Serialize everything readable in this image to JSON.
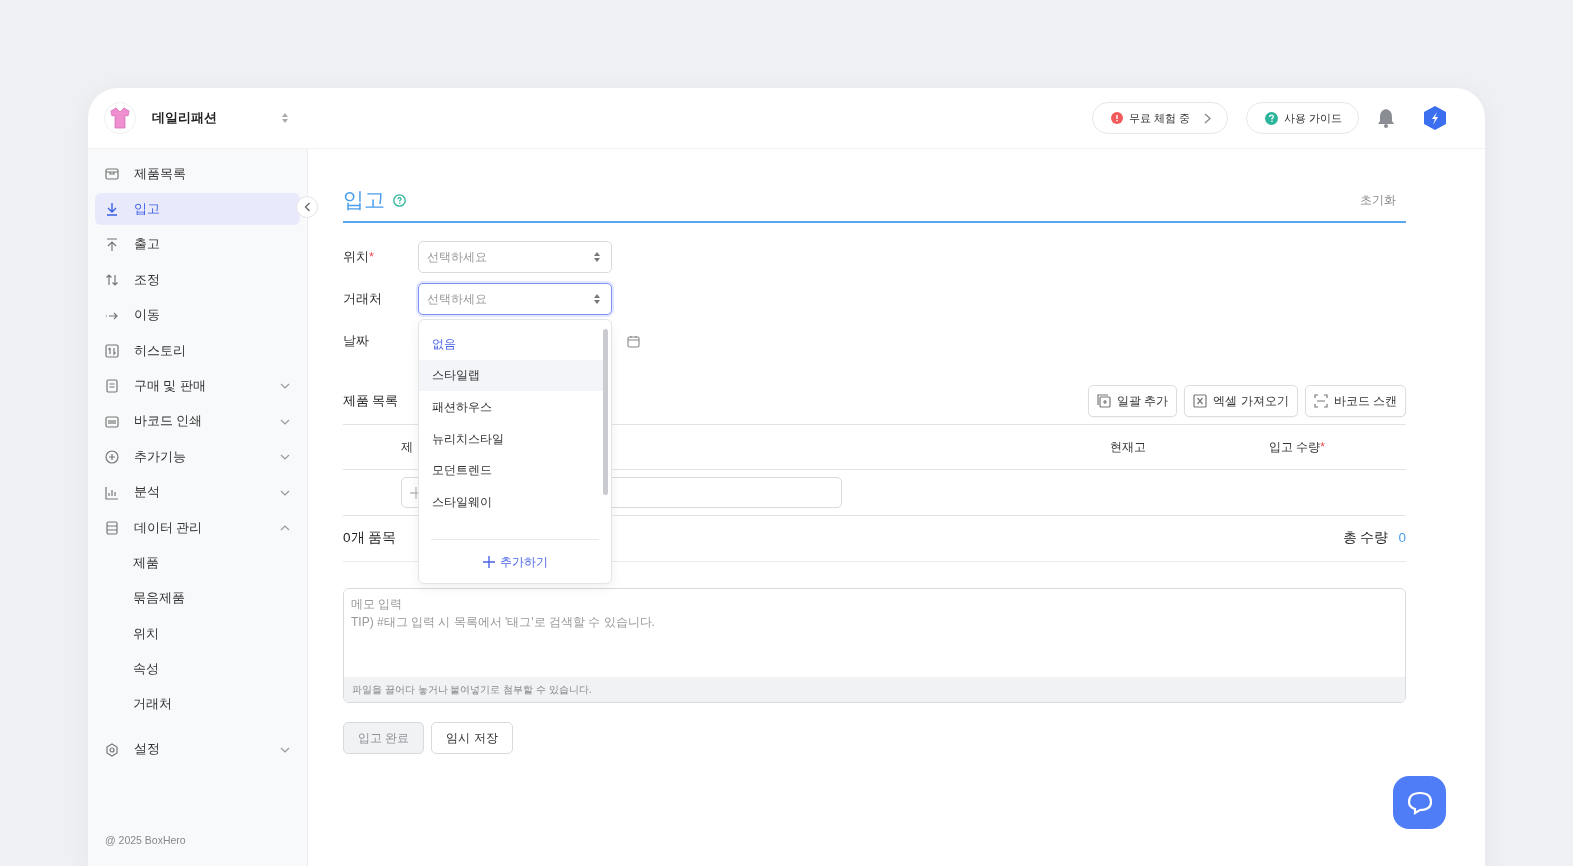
{
  "workspace": {
    "name": "데일리패션"
  },
  "header": {
    "trial_button": "무료 체험 중",
    "guide_button": "사용 가이드"
  },
  "sidebar": {
    "items": [
      {
        "label": "제품목록",
        "kind": "link",
        "selected": false
      },
      {
        "label": "입고",
        "kind": "link",
        "selected": true
      },
      {
        "label": "출고",
        "kind": "link",
        "selected": false
      },
      {
        "label": "조정",
        "kind": "link",
        "selected": false
      },
      {
        "label": "이동",
        "kind": "link",
        "selected": false
      },
      {
        "label": "히스토리",
        "kind": "link",
        "selected": false
      },
      {
        "label": "구매 및 판매",
        "kind": "group",
        "selected": false,
        "expanded": false
      },
      {
        "label": "바코드 인쇄",
        "kind": "group",
        "selected": false,
        "expanded": false
      },
      {
        "label": "추가기능",
        "kind": "group",
        "selected": false,
        "expanded": false
      },
      {
        "label": "분석",
        "kind": "group",
        "selected": false,
        "expanded": false
      },
      {
        "label": "데이터 관리",
        "kind": "group",
        "selected": false,
        "expanded": true,
        "children": [
          {
            "label": "제품",
            "selected": false
          },
          {
            "label": "묶음제품",
            "selected": false
          },
          {
            "label": "위치",
            "selected": false
          },
          {
            "label": "속성",
            "selected": false
          },
          {
            "label": "거래처",
            "selected": false
          }
        ]
      },
      {
        "label": "설정",
        "kind": "group",
        "selected": false,
        "expanded": false
      }
    ],
    "footer": "@ 2025 BoxHero"
  },
  "page": {
    "title": "입고",
    "reset_button": "초기화"
  },
  "form": {
    "fields": [
      {
        "label": "위치",
        "required_mark": "*",
        "kind": "select",
        "placeholder": "선택하세요",
        "focused": false
      },
      {
        "label": "거래처",
        "kind": "select",
        "placeholder": "선택하세요",
        "focused": true
      },
      {
        "label": "날짜",
        "kind": "date"
      }
    ]
  },
  "dropdown": {
    "options": [
      {
        "label": "없음",
        "selected": true,
        "hovered": false
      },
      {
        "label": "스타일랩",
        "selected": false,
        "hovered": true
      },
      {
        "label": "패션하우스",
        "selected": false,
        "hovered": false
      },
      {
        "label": "뉴리치스타일",
        "selected": false,
        "hovered": false
      },
      {
        "label": "모던트렌드",
        "selected": false,
        "hovered": false
      },
      {
        "label": "스타일웨이",
        "selected": false,
        "hovered": false
      }
    ],
    "add_button": "추가하기"
  },
  "products": {
    "label": "제품 목록",
    "actions": [
      "일괄 추가",
      "엑셀 가져오기",
      "바코드 스캔"
    ],
    "columns": [
      {
        "label": "제"
      },
      {
        "label": "현재고"
      },
      {
        "label": "입고 수량",
        "required_mark": "*"
      }
    ],
    "item_count": "0개 품목",
    "total_label": "총 수량",
    "total_value": "0"
  },
  "memo": {
    "placeholder": "메모 입력\nTIP) #태그 입력 시 목록에서 '태그'로 검색할 수 있습니다.",
    "attach_hint": "파일을 끌어다 놓거나 붙여넣기로 첨부할 수 있습니다."
  },
  "buttons": [
    {
      "label": "입고 완료",
      "disabled": true
    },
    {
      "label": "임시 저장",
      "disabled": false
    }
  ]
}
